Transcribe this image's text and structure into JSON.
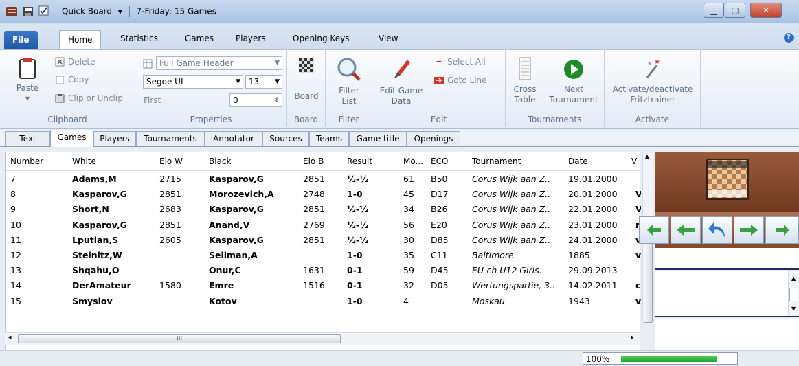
{
  "titlebar": {
    "quick_board": "Quick Board",
    "title": "7-Friday: 15 Games"
  },
  "ribbon_tabs": [
    "File",
    "Home",
    "Statistics",
    "Games",
    "Players",
    "Opening Keys",
    "View"
  ],
  "clipboard": {
    "paste": "Paste",
    "delete": "Delete",
    "copy": "Copy",
    "clip": "Clip or Unclip",
    "label": "Clipboard"
  },
  "properties": {
    "header_combo": "Full Game Header",
    "font_combo": "Segoe UI",
    "size_combo": "13",
    "first_label": "First",
    "first_value": "0",
    "label": "Properties"
  },
  "board_group": {
    "button": "Board",
    "label": "Board"
  },
  "filter_group": {
    "button_line1": "Filter",
    "button_line2": "List",
    "label": "Filter"
  },
  "edit_group": {
    "edit_line1": "Edit Game",
    "edit_line2": "Data",
    "select_all": "Select All",
    "goto_line": "Goto Line",
    "label": "Edit"
  },
  "tournaments_group": {
    "cross_line1": "Cross",
    "cross_line2": "Table",
    "next_line1": "Next",
    "next_line2": "Tournament",
    "label": "Tournaments"
  },
  "activate_group": {
    "line1": "Activate/deactivate",
    "line2": "Fritztrainer",
    "label": "Activate"
  },
  "doc_tabs": [
    "Text",
    "Games",
    "Players",
    "Tournaments",
    "Annotator",
    "Sources",
    "Teams",
    "Game title",
    "Openings"
  ],
  "columns": [
    "Number",
    "White",
    "Elo W",
    "Black",
    "Elo B",
    "Result",
    "Mo...",
    "ECO",
    "Tournament",
    "Date",
    "V"
  ],
  "rows": [
    {
      "num": "7",
      "white": "Adams,M",
      "elow": "2715",
      "black": "Kasparov,G",
      "elob": "2851",
      "result": "½-½",
      "moves": "61",
      "eco": "B50",
      "tournament": "Corus Wijk aan Z..",
      "date": "19.01.2000",
      "v": ""
    },
    {
      "num": "8",
      "white": "Kasparov,G",
      "elow": "2851",
      "black": "Morozevich,A",
      "elob": "2748",
      "result": "1-0",
      "moves": "45",
      "eco": "D17",
      "tournament": "Corus Wijk aan Z..",
      "date": "20.01.2000",
      "v": "V"
    },
    {
      "num": "9",
      "white": "Short,N",
      "elow": "2683",
      "black": "Kasparov,G",
      "elob": "2851",
      "result": "½-½",
      "moves": "34",
      "eco": "B26",
      "tournament": "Corus Wijk aan Z..",
      "date": "22.01.2000",
      "v": "V"
    },
    {
      "num": "10",
      "white": "Kasparov,G",
      "elow": "2851",
      "black": "Anand,V",
      "elob": "2769",
      "result": "½-½",
      "moves": "56",
      "eco": "E20",
      "tournament": "Corus Wijk aan Z..",
      "date": "23.01.2000",
      "v": "r("
    },
    {
      "num": "11",
      "white": "Lputian,S",
      "elow": "2605",
      "black": "Kasparov,G",
      "elob": "2851",
      "result": "½-½",
      "moves": "30",
      "eco": "D85",
      "tournament": "Corus Wijk aan Z..",
      "date": "24.01.2000",
      "v": "v("
    },
    {
      "num": "12",
      "white": "Steinitz,W",
      "elow": "",
      "black": "Sellman,A",
      "elob": "",
      "result": "1-0",
      "moves": "35",
      "eco": "C11",
      "tournament": "Baltimore",
      "date": "1885",
      "v": "v("
    },
    {
      "num": "13",
      "white": "Shqahu,O",
      "elow": "",
      "black": "Onur,C",
      "elob": "1631",
      "result": "0-1",
      "moves": "59",
      "eco": "D45",
      "tournament": "EU-ch U12 Girls..",
      "date": "29.09.2013",
      "v": ""
    },
    {
      "num": "14",
      "white": "DerAmateur",
      "elow": "1580",
      "black": "Emre",
      "elob": "1516",
      "result": "0-1",
      "moves": "32",
      "eco": "D05",
      "tournament": "Wertungspartie, 3..",
      "date": "14.02.2011",
      "v": "c"
    },
    {
      "num": "15",
      "white": "Smyslov",
      "elow": "",
      "black": "Kotov",
      "elob": "",
      "result": "1-0",
      "moves": "4",
      "eco": "",
      "tournament": "Moskau",
      "date": "1943",
      "v": "v:"
    }
  ],
  "status": {
    "zoom_text": "100%",
    "progress": 0.85
  },
  "colors": {
    "accent": "#1f5aa6",
    "board_bg": "#7a4428",
    "progress": "#22a82d"
  }
}
